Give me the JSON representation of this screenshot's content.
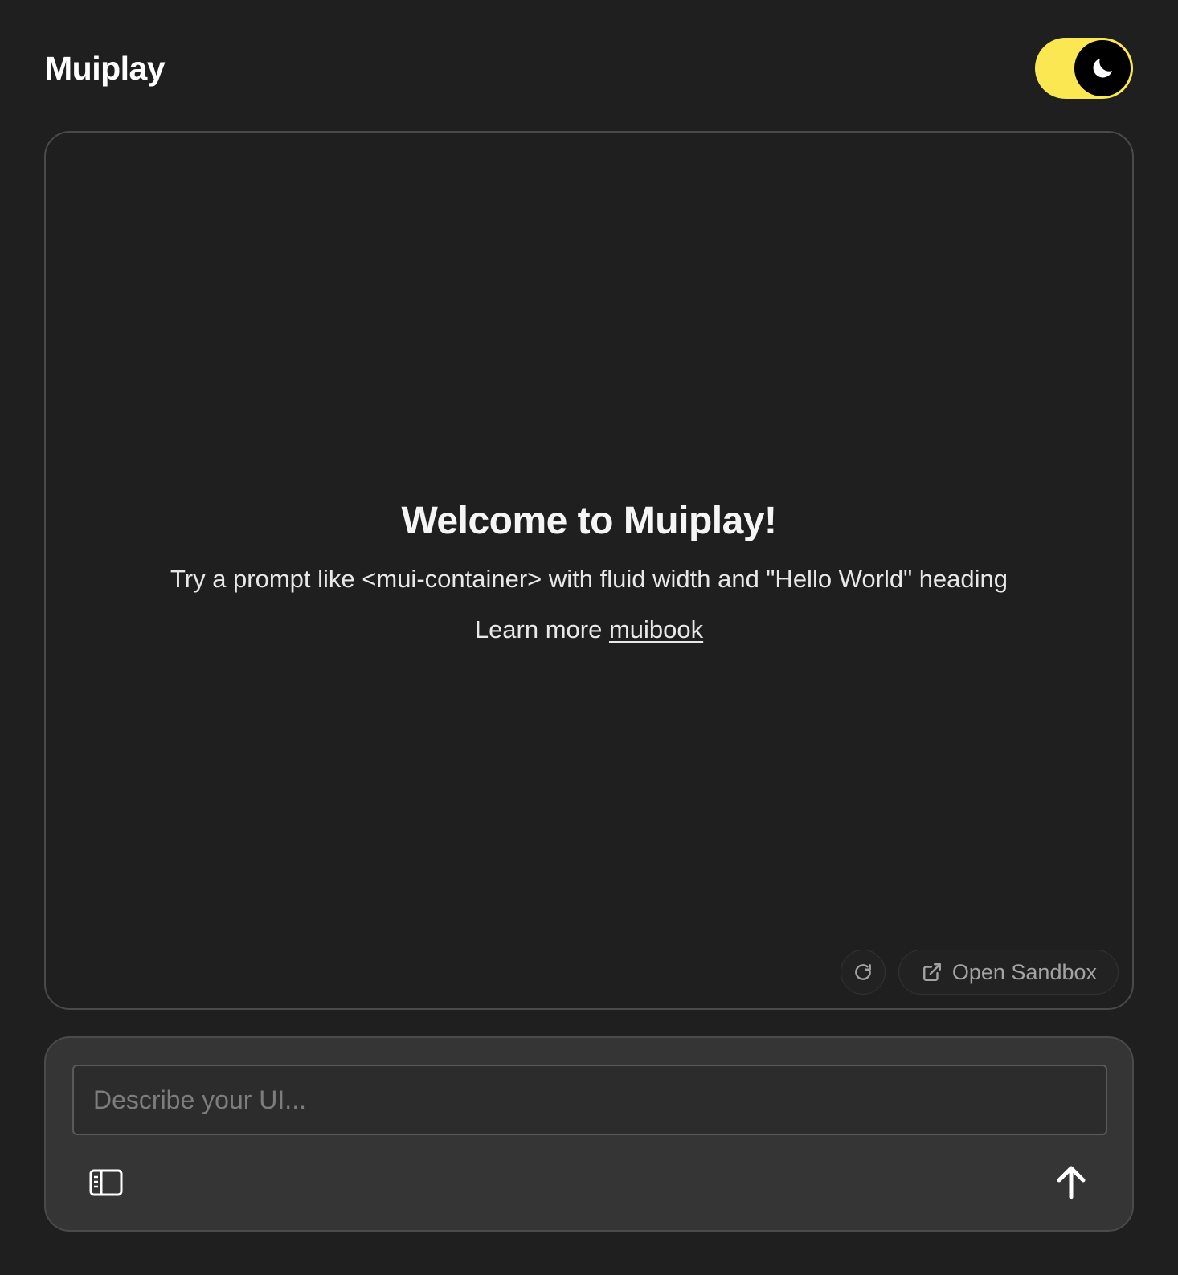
{
  "header": {
    "title": "Muiplay",
    "theme_toggle": {
      "state": "dark",
      "icon": "moon-icon",
      "track_color": "#fbe752"
    }
  },
  "preview": {
    "welcome_title": "Welcome to Muiplay!",
    "hint": "Try a prompt like <mui-container> with fluid width and \"Hello World\" heading",
    "learn_prefix": "Learn more ",
    "learn_link": "muibook",
    "actions": {
      "refresh_icon": "refresh-icon",
      "sandbox_icon": "external-link-icon",
      "sandbox_label": "Open Sandbox"
    }
  },
  "composer": {
    "input_value": "",
    "placeholder": "Describe your UI...",
    "sidebar_icon": "sidebar-icon",
    "send_icon": "arrow-up-icon"
  },
  "colors": {
    "background": "#1f1f1f",
    "accent": "#fbe752",
    "composer_bg": "#353535"
  }
}
